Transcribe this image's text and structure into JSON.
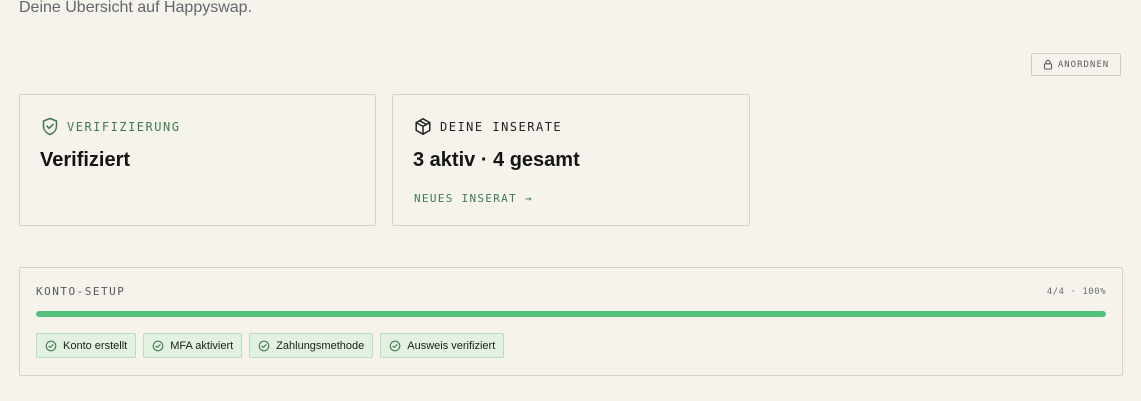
{
  "header": {
    "subtitle": "Deine Übersicht auf Happyswap."
  },
  "toolbar": {
    "arrange_label": "ANORDNEN",
    "arrange_icon": "lock-icon"
  },
  "cards": {
    "verification": {
      "icon": "shield-check-icon",
      "label": "VERIFIZIERUNG",
      "value": "Verifiziert",
      "accent": "#3f7a4f"
    },
    "listings": {
      "icon": "package-icon",
      "label": "DEINE INSERATE",
      "value": "3 aktiv · 4 gesamt",
      "link_label": "NEUES INSERAT →"
    }
  },
  "setup": {
    "title": "KONTO-SETUP",
    "progress_text": "4/4 · 100%",
    "progress_fraction": 1.0,
    "progress_color": "#53c07c",
    "steps": [
      {
        "label": "Konto erstellt",
        "icon": "check-circle-icon"
      },
      {
        "label": "MFA aktiviert",
        "icon": "check-circle-icon"
      },
      {
        "label": "Zahlungsmethode",
        "icon": "check-circle-icon"
      },
      {
        "label": "Ausweis verifiziert",
        "icon": "check-circle-icon"
      }
    ]
  }
}
